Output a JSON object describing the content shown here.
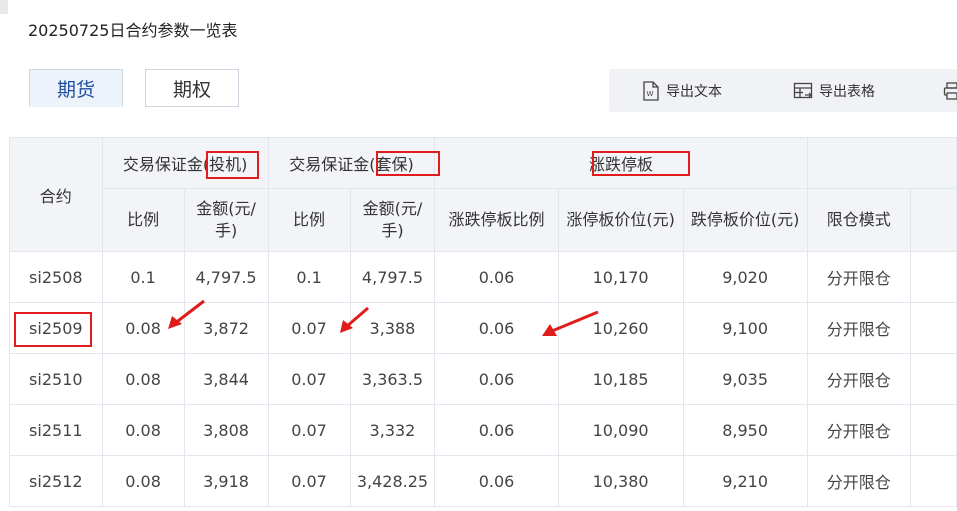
{
  "page": {
    "title": "20250725日合约参数一览表"
  },
  "tabs": [
    {
      "label": "期货",
      "active": true
    },
    {
      "label": "期权",
      "active": false
    }
  ],
  "toolbar": {
    "export_text": "导出文本",
    "export_table": "导出表格",
    "print_icon": "print-icon",
    "word_icon": "word-doc-icon",
    "table_icon": "table-export-icon"
  },
  "table": {
    "group_headers": {
      "contract": "合约",
      "margin_spec_prefix": "交易保证金",
      "margin_spec_suffix": "(投机)",
      "margin_hedge_prefix": "交易保证金",
      "margin_hedge_suffix": "(套保)",
      "price_limit": "涨跌停板"
    },
    "sub_headers": {
      "ratio_spec": "比例",
      "amount_spec_l1": "金额(元/",
      "amount_spec_l2": "手)",
      "ratio_hedge": "比例",
      "amount_hedge_l1": "金额(元/",
      "amount_hedge_l2": "手)",
      "limit_ratio": "涨跌停板比例",
      "limit_up": "涨停板价位(元)",
      "limit_down": "跌停板价位(元)",
      "position_mode": "限仓模式"
    },
    "rows": [
      {
        "contract": "si2508",
        "ratio_spec": "0.1",
        "amount_spec": "4,797.5",
        "ratio_hedge": "0.1",
        "amount_hedge": "4,797.5",
        "limit_ratio": "0.06",
        "limit_up": "10,170",
        "limit_down": "9,020",
        "mode": "分开限仓"
      },
      {
        "contract": "si2509",
        "ratio_spec": "0.08",
        "amount_spec": "3,872",
        "ratio_hedge": "0.07",
        "amount_hedge": "3,388",
        "limit_ratio": "0.06",
        "limit_up": "10,260",
        "limit_down": "9,100",
        "mode": "分开限仓"
      },
      {
        "contract": "si2510",
        "ratio_spec": "0.08",
        "amount_spec": "3,844",
        "ratio_hedge": "0.07",
        "amount_hedge": "3,363.5",
        "limit_ratio": "0.06",
        "limit_up": "10,185",
        "limit_down": "9,035",
        "mode": "分开限仓"
      },
      {
        "contract": "si2511",
        "ratio_spec": "0.08",
        "amount_spec": "3,808",
        "ratio_hedge": "0.07",
        "amount_hedge": "3,332",
        "limit_ratio": "0.06",
        "limit_up": "10,090",
        "limit_down": "8,950",
        "mode": "分开限仓"
      },
      {
        "contract": "si2512",
        "ratio_spec": "0.08",
        "amount_spec": "3,918",
        "ratio_hedge": "0.07",
        "amount_hedge": "3,428.25",
        "limit_ratio": "0.06",
        "limit_up": "10,380",
        "limit_down": "9,210",
        "mode": "分开限仓"
      }
    ]
  },
  "annotations": {
    "highlight_color": "#e01c1c"
  }
}
